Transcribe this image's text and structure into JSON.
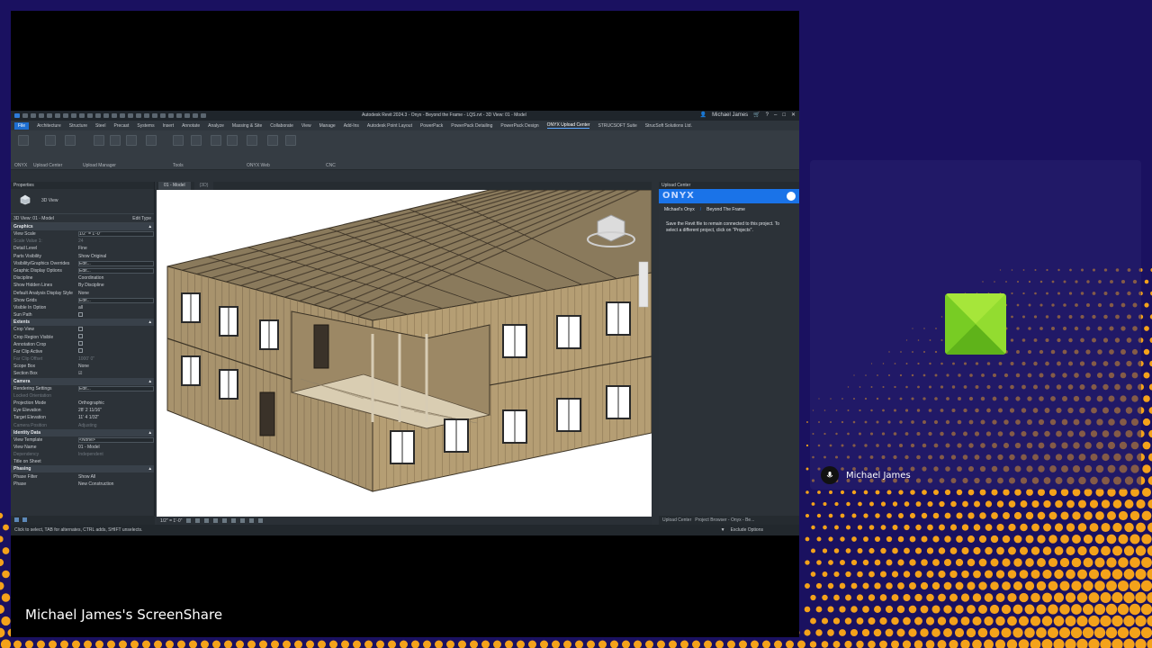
{
  "app": {
    "title": "Autodesk Revit 2024.3 - Onyx - Beyond the Frame - LQS.rvt - 3D View: 01 - Model",
    "user": "Michael James",
    "window_controls": [
      "–",
      "□",
      "✕"
    ]
  },
  "ribbon": {
    "tabs": [
      "File",
      "Architecture",
      "Structure",
      "Steel",
      "Precast",
      "Systems",
      "Insert",
      "Annotate",
      "Analyze",
      "Massing & Site",
      "Collaborate",
      "View",
      "Manage",
      "Add-Ins",
      "Autodesk Point Layout",
      "PowerPack",
      "PowerPack Detailing",
      "PowerPack Design",
      "ONYX Upload Center",
      "STRUCSOFT Suite",
      "StrucSoft Solutions Ltd."
    ],
    "active_tab": "ONYX Upload Center",
    "groups": [
      "ONYX",
      "Upload Center",
      "Upload Manager",
      "Tools",
      "ONYX Web",
      "CNC"
    ]
  },
  "properties": {
    "title": "Properties",
    "type_name": "3D View",
    "filter_label": "3D View: 01 - Model",
    "edit_type": "Edit Type",
    "sections": [
      {
        "name": "Graphics",
        "rows": [
          {
            "name": "View Scale",
            "value": "1/2\" = 1'-0\"",
            "kind": "box"
          },
          {
            "name": "Scale Value 1:",
            "value": "24",
            "kind": "disabled"
          },
          {
            "name": "Detail Level",
            "value": "Fine",
            "kind": "text"
          },
          {
            "name": "Parts Visibility",
            "value": "Show Original",
            "kind": "text"
          },
          {
            "name": "Visibility/Graphics Overrides",
            "value": "Edit...",
            "kind": "box"
          },
          {
            "name": "Graphic Display Options",
            "value": "Edit...",
            "kind": "box"
          },
          {
            "name": "Discipline",
            "value": "Coordination",
            "kind": "text"
          },
          {
            "name": "Show Hidden Lines",
            "value": "By Discipline",
            "kind": "text"
          },
          {
            "name": "Default Analysis Display Style",
            "value": "None",
            "kind": "text"
          },
          {
            "name": "Show Grids",
            "value": "Edit...",
            "kind": "box"
          },
          {
            "name": "Visible In Option",
            "value": "all",
            "kind": "text"
          },
          {
            "name": "Sun Path",
            "value": "",
            "kind": "check"
          }
        ]
      },
      {
        "name": "Extents",
        "rows": [
          {
            "name": "Crop View",
            "value": "",
            "kind": "check"
          },
          {
            "name": "Crop Region Visible",
            "value": "",
            "kind": "check"
          },
          {
            "name": "Annotation Crop",
            "value": "",
            "kind": "check"
          },
          {
            "name": "Far Clip Active",
            "value": "",
            "kind": "check"
          },
          {
            "name": "Far Clip Offset",
            "value": "1000' 0\"",
            "kind": "disabled"
          },
          {
            "name": "Scope Box",
            "value": "None",
            "kind": "text"
          },
          {
            "name": "Section Box",
            "value": "☑",
            "kind": "text"
          }
        ]
      },
      {
        "name": "Camera",
        "rows": [
          {
            "name": "Rendering Settings",
            "value": "Edit...",
            "kind": "box"
          },
          {
            "name": "Locked Orientation",
            "value": "",
            "kind": "disabled"
          },
          {
            "name": "Projection Mode",
            "value": "Orthographic",
            "kind": "text"
          },
          {
            "name": "Eye Elevation",
            "value": "28' 2 11/16\"",
            "kind": "text"
          },
          {
            "name": "Target Elevation",
            "value": "11' 4 1/32\"",
            "kind": "text"
          },
          {
            "name": "Camera Position",
            "value": "Adjusting",
            "kind": "disabled"
          }
        ]
      },
      {
        "name": "Identity Data",
        "rows": [
          {
            "name": "View Template",
            "value": "<None>",
            "kind": "box"
          },
          {
            "name": "View Name",
            "value": "01 - Model",
            "kind": "text"
          },
          {
            "name": "Dependency",
            "value": "Independent",
            "kind": "disabled"
          },
          {
            "name": "Title on Sheet",
            "value": "",
            "kind": "text"
          }
        ]
      },
      {
        "name": "Phasing",
        "rows": [
          {
            "name": "Phase Filter",
            "value": "Show All",
            "kind": "text"
          },
          {
            "name": "Phase",
            "value": "New Construction",
            "kind": "text"
          }
        ]
      }
    ],
    "help_link": "Properties help",
    "apply": "Apply"
  },
  "view_tabs": [
    "01 - Model",
    "{3D}"
  ],
  "view_control_scale": "1/2\" = 1'-0\"",
  "upload_center": {
    "title": "Upload Center",
    "logo": "ONYX",
    "crumbs": [
      "Michael's Onyx",
      "/",
      "Beyond The Frame"
    ],
    "message": "Save the Revit file to remain connected to this project. To select a different project, click on \"Projects\".",
    "bottom_tabs": [
      "Upload Center",
      "Project Browser - Onyx - Be..."
    ]
  },
  "status_bar": {
    "text": "Click to select, TAB for alternates, CTRL adds, SHIFT unselects.",
    "right_text": "Exclude Options"
  },
  "meeting": {
    "screenshare_caption": "Michael James's ScreenShare",
    "participant_name": "Michael James",
    "accent": "#7fd321"
  }
}
